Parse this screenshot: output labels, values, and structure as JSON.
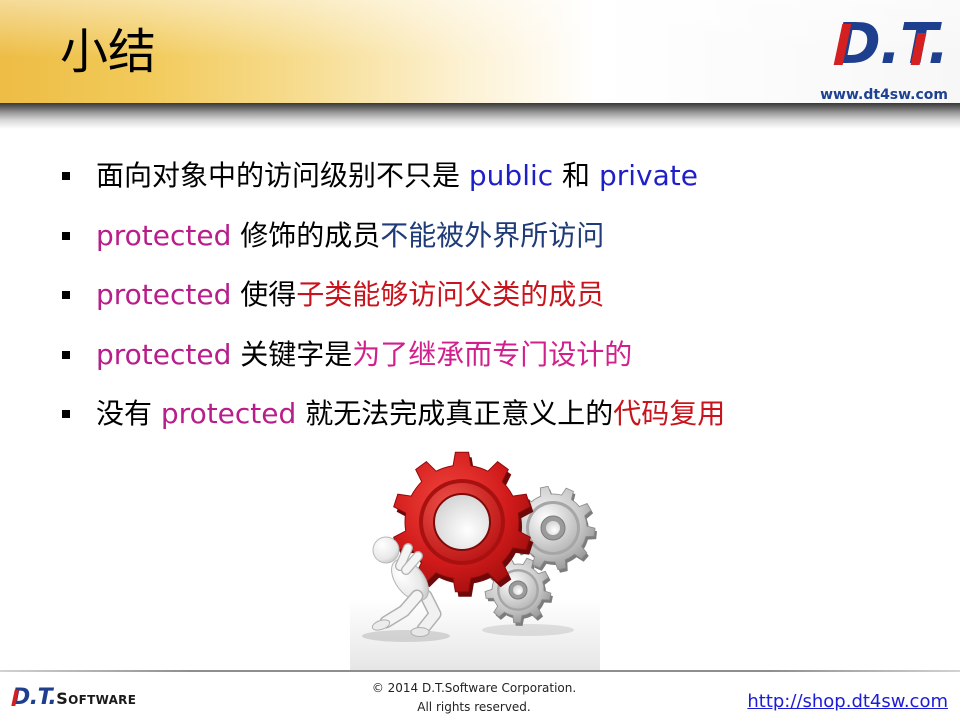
{
  "header": {
    "title": "小结",
    "logo": {
      "mark": [
        "D",
        ".",
        "T",
        "."
      ],
      "url": "www.dt4sw.com"
    }
  },
  "bullets": [
    {
      "segments": [
        {
          "text": "面向对象中的访问级别不只是 ",
          "color": "#000000"
        },
        {
          "text": "public",
          "color": "#1f1fc8"
        },
        {
          "text": " 和 ",
          "color": "#000000"
        },
        {
          "text": "private",
          "color": "#1f1fc8"
        }
      ]
    },
    {
      "segments": [
        {
          "text": "protected",
          "color": "#b81e8a"
        },
        {
          "text": " 修饰的成员",
          "color": "#000000"
        },
        {
          "text": "不能被外界所访问",
          "color": "#1f3b78"
        }
      ]
    },
    {
      "segments": [
        {
          "text": "protected",
          "color": "#b81e8a"
        },
        {
          "text": " 使得",
          "color": "#000000"
        },
        {
          "text": "子类能够访问父类的成员",
          "color": "#c8141c"
        }
      ]
    },
    {
      "segments": [
        {
          "text": "protected",
          "color": "#b81e8a"
        },
        {
          "text": " 关键字是",
          "color": "#000000"
        },
        {
          "text": "为了继承而专门设计的",
          "color": "#d0208c"
        }
      ]
    },
    {
      "segments": [
        {
          "text": "没有 ",
          "color": "#000000"
        },
        {
          "text": "protected",
          "color": "#b81e8a"
        },
        {
          "text": " 就无法完成真正意义上的",
          "color": "#000000"
        },
        {
          "text": "代码复用",
          "color": "#c8141c"
        }
      ]
    }
  ],
  "footer": {
    "logo": {
      "mark": [
        "D",
        ".",
        "T",
        "."
      ],
      "word": "SOFTWARE"
    },
    "copyright": "© 2014 D.T.Software Corporation.",
    "rights": "All rights reserved.",
    "link": "http://shop.dt4sw.com"
  },
  "colors": {
    "logo_blue": "#1e3f8e",
    "logo_red": "#d42020",
    "url_blue": "#1e4293",
    "link_blue": "#1c1cd8"
  }
}
